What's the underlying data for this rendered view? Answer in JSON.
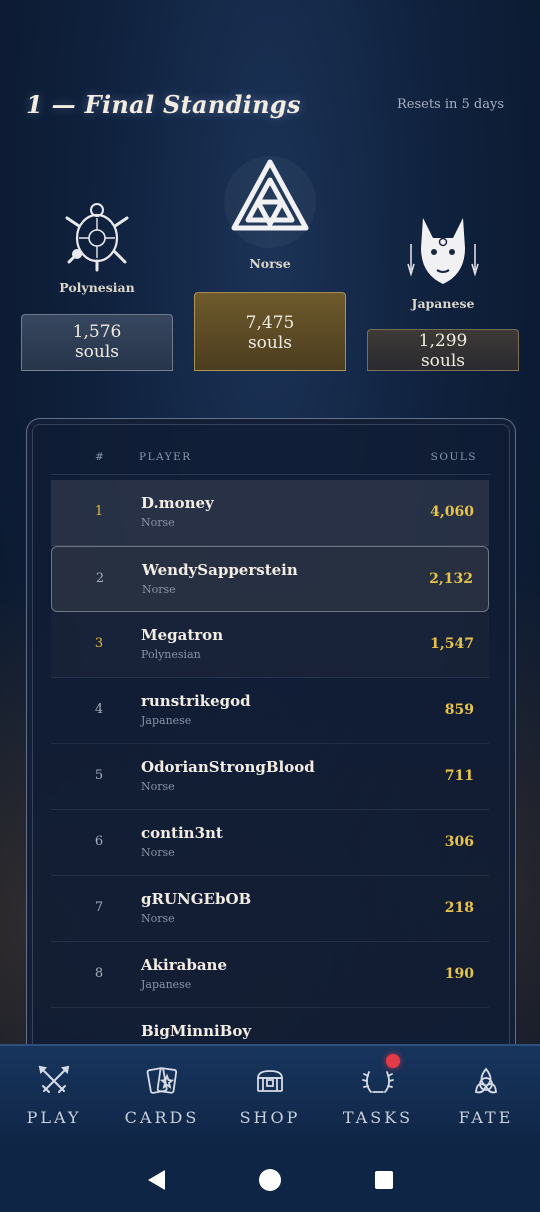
{
  "header": {
    "title": "1 — Final Standings",
    "resets": "Resets in 5 days"
  },
  "podium": [
    {
      "name": "Polynesian",
      "souls": "1,576",
      "unit": "souls",
      "emblem": "turtle-icon"
    },
    {
      "name": "Norse",
      "souls": "7,475",
      "unit": "souls",
      "emblem": "valknut-icon"
    },
    {
      "name": "Japanese",
      "souls": "1,299",
      "unit": "souls",
      "emblem": "kitsune-mask-icon"
    }
  ],
  "table": {
    "headers": {
      "rank": "#",
      "player": "PLAYER",
      "souls": "SOULS"
    },
    "rows": [
      {
        "rank": "1",
        "name": "D.money",
        "faction": "Norse",
        "souls": "4,060"
      },
      {
        "rank": "2",
        "name": "WendySapperstein",
        "faction": "Norse",
        "souls": "2,132"
      },
      {
        "rank": "3",
        "name": "Megatron",
        "faction": "Polynesian",
        "souls": "1,547"
      },
      {
        "rank": "4",
        "name": "runstrikegod",
        "faction": "Japanese",
        "souls": "859"
      },
      {
        "rank": "5",
        "name": "OdorianStrongBlood",
        "faction": "Norse",
        "souls": "711"
      },
      {
        "rank": "6",
        "name": "contin3nt",
        "faction": "Norse",
        "souls": "306"
      },
      {
        "rank": "7",
        "name": "gRUNGEbOB",
        "faction": "Norse",
        "souls": "218"
      },
      {
        "rank": "8",
        "name": "Akirabane",
        "faction": "Japanese",
        "souls": "190"
      },
      {
        "rank": "",
        "name": "BigMinniBoy",
        "faction": "",
        "souls": ""
      }
    ]
  },
  "nav": {
    "items": [
      {
        "label": "PLAY",
        "icon": "crossed-swords-icon"
      },
      {
        "label": "CARDS",
        "icon": "cards-icon"
      },
      {
        "label": "SHOP",
        "icon": "chest-icon"
      },
      {
        "label": "TASKS",
        "icon": "laurel-icon"
      },
      {
        "label": "FATE",
        "icon": "triquetra-icon"
      }
    ]
  },
  "colors": {
    "accent_gold": "#e8c44a",
    "badge": "#e53b48",
    "background": "#0f213d"
  }
}
